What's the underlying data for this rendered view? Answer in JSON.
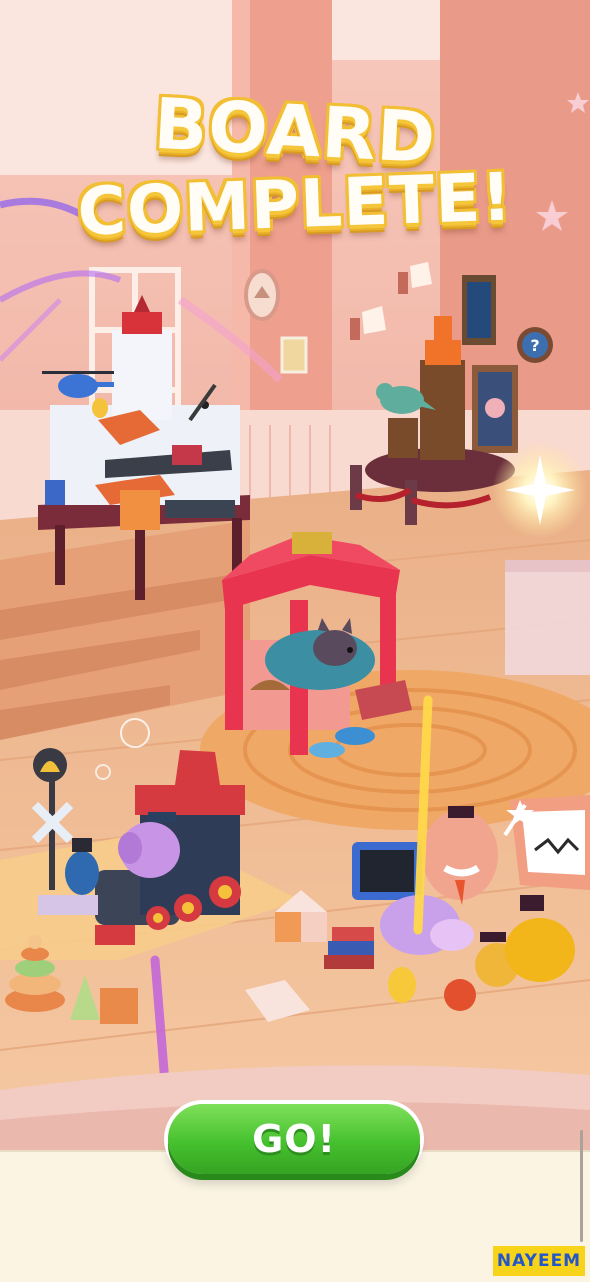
{
  "banner": {
    "line1": "BOARD",
    "line2": "COMPLETE!"
  },
  "actions": {
    "go_label": "GO!"
  },
  "overlay": {
    "watermark": "NAYEEM"
  },
  "colors": {
    "title_fill": "#fffdf5",
    "title_outline": "#f2be34",
    "go_button": "#46c12e",
    "wall": "#f2b7a8",
    "floor": "#f0b98a",
    "rug": "#f0a866",
    "canopy": "#e8344f",
    "watermark_bg": "#f7d31a",
    "watermark_text": "#2357c9"
  },
  "icons": [
    "model-town-icon",
    "helicopter-icon",
    "trophy-pedestal-icon",
    "dinosaur-figurine-icon",
    "canopy-pet-bed-icon",
    "cat-icon",
    "toy-train-icon",
    "elephant-plush-icon",
    "bell-signal-icon",
    "stacking-rings-icon",
    "tv-robot-icon",
    "walrus-plush-icon",
    "sparkle-icon"
  ]
}
